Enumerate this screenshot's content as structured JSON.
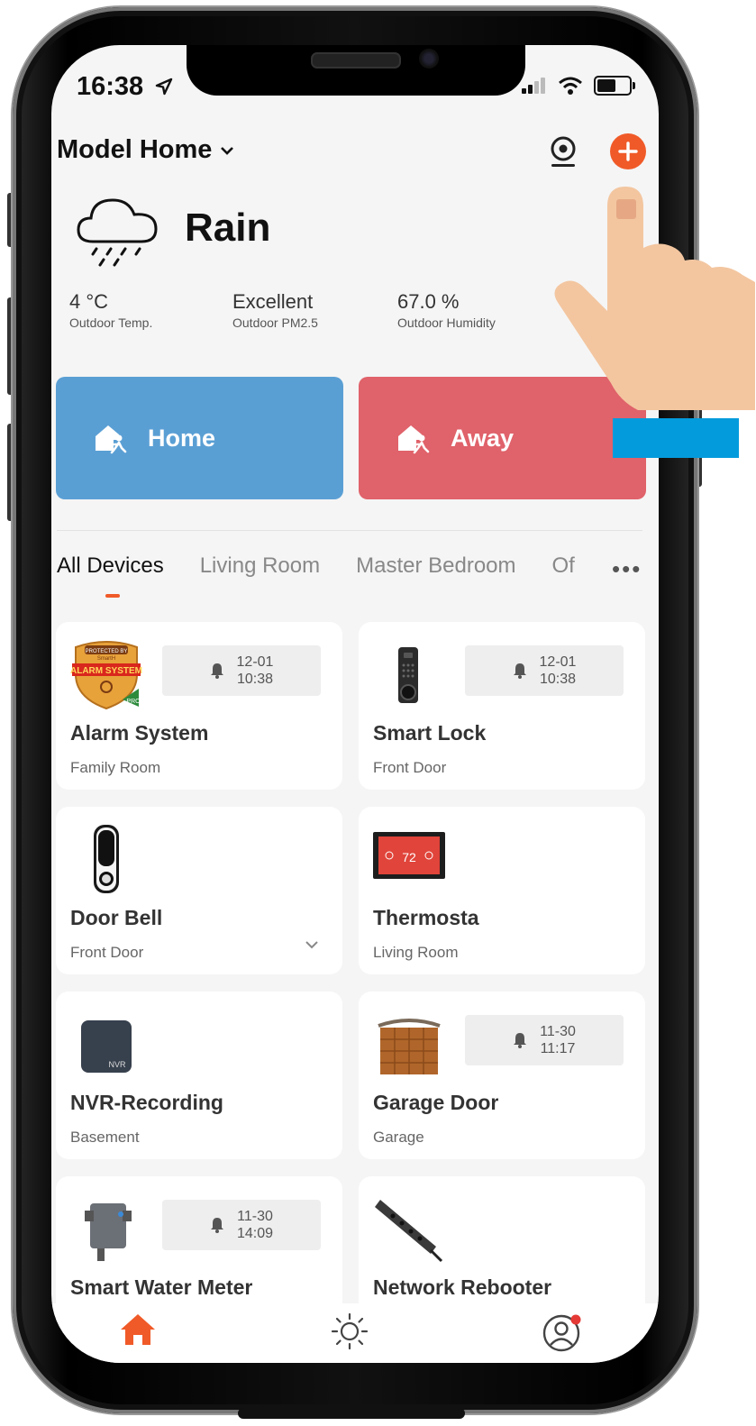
{
  "status": {
    "time": "16:38"
  },
  "header": {
    "home_name": "Model Home"
  },
  "weather": {
    "condition": "Rain",
    "stats": [
      {
        "value": "4 °C",
        "label": "Outdoor Temp."
      },
      {
        "value": "Excellent",
        "label": "Outdoor PM2.5"
      },
      {
        "value": "67.0 %",
        "label": "Outdoor Humidity"
      }
    ]
  },
  "modes": [
    {
      "label": "Home",
      "color": "#5a9fd4"
    },
    {
      "label": "Away",
      "color": "#e0626a"
    }
  ],
  "tabs": [
    "All Devices",
    "Living Room",
    "Master Bedroom",
    "Of"
  ],
  "devices": [
    {
      "name": "Alarm System",
      "room": "Family Room",
      "alert_date": "12-01",
      "alert_time": "10:38"
    },
    {
      "name": "Smart Lock",
      "room": "Front Door",
      "alert_date": "12-01",
      "alert_time": "10:38"
    },
    {
      "name": "Door Bell",
      "room": "Front Door"
    },
    {
      "name": "Thermosta",
      "room": "Living Room",
      "thermo_value": "72"
    },
    {
      "name": "NVR-Recording",
      "room": "Basement",
      "thumb_label": "NVR"
    },
    {
      "name": "Garage Door",
      "room": "Garage",
      "alert_date": "11-30",
      "alert_time": "11:17"
    },
    {
      "name": "Smart Water Meter",
      "room": "",
      "alert_date": "11-30",
      "alert_time": "14:09"
    },
    {
      "name": "Network Rebooter",
      "room": ""
    }
  ],
  "badge_text": {
    "line1": "PROTECTED BY",
    "line2": "SmartH",
    "line3": "ALARM SYSTEM",
    "line4": "PRO"
  },
  "colors": {
    "accent": "#f05a28",
    "overlay_blue": "#049bdc"
  },
  "icons": [
    "location-arrow-icon",
    "cellular-signal-icon",
    "wifi-icon",
    "battery-icon",
    "chevron-down-icon",
    "camera-icon",
    "plus-icon",
    "rain-cloud-icon",
    "home-mode-icon",
    "away-mode-icon",
    "bell-icon",
    "home-icon",
    "sun-icon",
    "profile-icon"
  ]
}
